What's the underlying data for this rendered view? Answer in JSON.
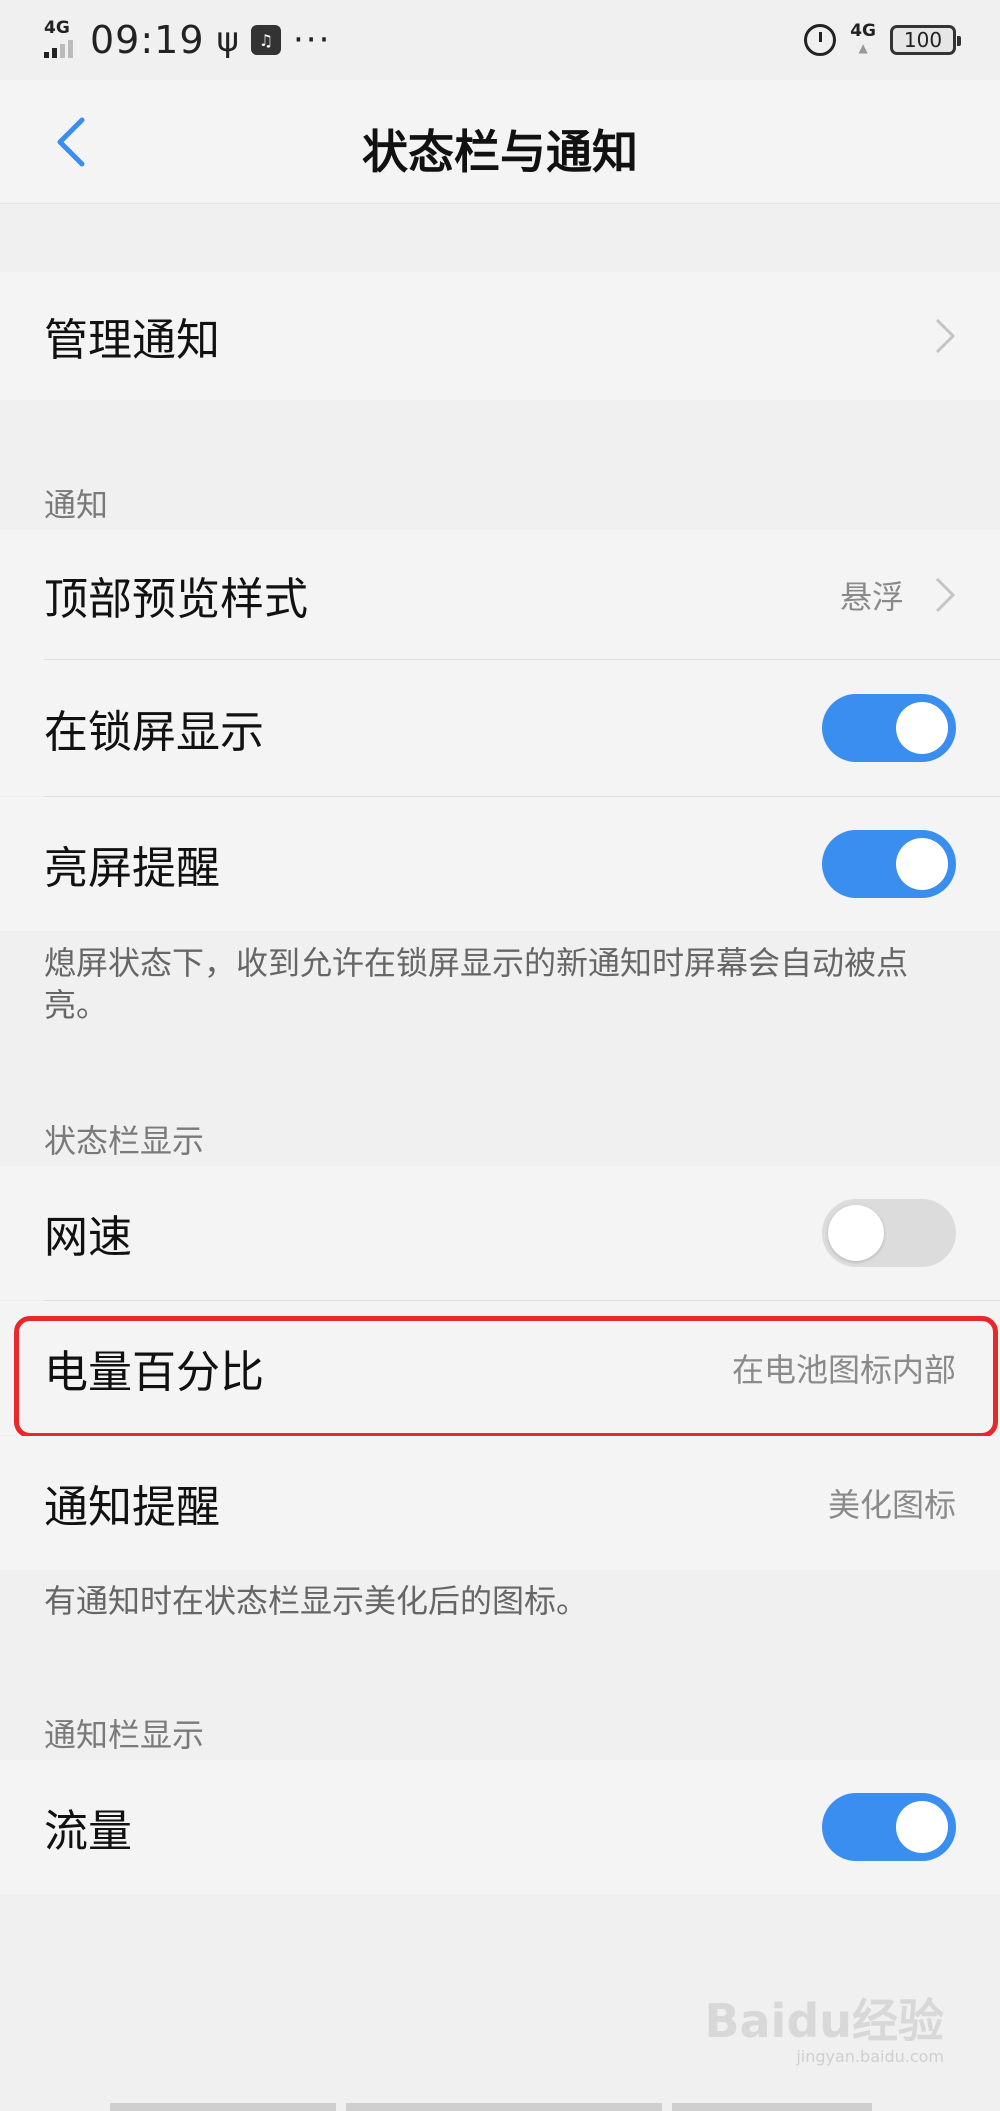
{
  "status_bar": {
    "network": "4G",
    "time": "09:19",
    "usb_icon": "usb-icon",
    "dots": "···",
    "network_right": "4G",
    "battery": "100"
  },
  "header": {
    "title": "状态栏与通知"
  },
  "manage": {
    "label": "管理通知"
  },
  "notification_section": {
    "header": "通知",
    "top_preview": {
      "label": "顶部预览样式",
      "value": "悬浮"
    },
    "lock_screen": {
      "label": "在锁屏显示",
      "enabled": true
    },
    "wake_screen": {
      "label": "亮屏提醒",
      "enabled": true
    },
    "description": "熄屏状态下，收到允许在锁屏显示的新通知时屏幕会自动被点亮。"
  },
  "status_bar_section": {
    "header": "状态栏显示",
    "net_speed": {
      "label": "网速",
      "enabled": false
    },
    "battery_percent": {
      "label": "电量百分比",
      "value": "在电池图标内部"
    },
    "notify_reminder": {
      "label": "通知提醒",
      "value": "美化图标"
    },
    "description": "有通知时在状态栏显示美化后的图标。"
  },
  "notification_bar_section": {
    "header": "通知栏显示",
    "traffic": {
      "label": "流量",
      "enabled": true
    }
  },
  "watermark": {
    "logo": "Baidu经验",
    "url": "jingyan.baidu.com"
  },
  "colors": {
    "accent": "#3a8ef0",
    "highlight": "#e8282b"
  }
}
